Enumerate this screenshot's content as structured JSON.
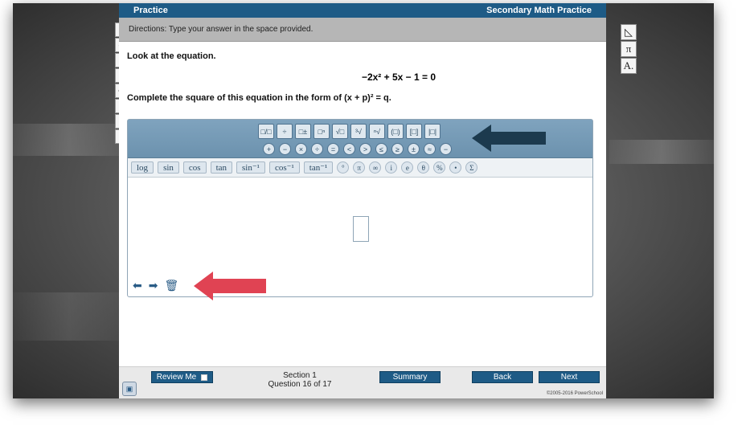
{
  "header": {
    "left_title": "Practice",
    "right_title": "Secondary Math Practice"
  },
  "directions": "Directions: Type your answer in the space provided.",
  "question": {
    "prompt": "Look at the equation.",
    "equation": "−2x² + 5x − 1 = 0",
    "instruction": "Complete the square of this equation in the form of (x + p)² = q."
  },
  "left_tools": [
    {
      "name": "pointer-icon",
      "glyph": "↖"
    },
    {
      "name": "protractor-icon",
      "glyph": "◠"
    },
    {
      "name": "highlighter-icon",
      "glyph": "✎"
    },
    {
      "name": "eraser-icon",
      "glyph": "▮"
    },
    {
      "name": "pencil-icon",
      "glyph": "✏"
    },
    {
      "name": "ruler-icon",
      "glyph": "═"
    },
    {
      "name": "eliminate-icon",
      "glyph": "✕"
    },
    {
      "name": "scratchwork-icon",
      "glyph": "∿"
    }
  ],
  "right_tools": [
    {
      "name": "triangle-icon",
      "glyph": "◺"
    },
    {
      "name": "pi-icon",
      "glyph": "π"
    },
    {
      "name": "notepad-icon",
      "glyph": "A."
    }
  ],
  "editor": {
    "templates": [
      "□/□",
      "÷",
      "□±",
      "□ⁿ",
      "√□",
      "³√",
      "ⁿ√",
      "(□)",
      "[□]",
      "|□|"
    ],
    "operators": [
      "+",
      "−",
      "×",
      "÷",
      "=",
      "<",
      ">",
      "≤",
      "≥",
      "±",
      "≈",
      "−"
    ],
    "functions": [
      "log",
      "sin",
      "cos",
      "tan",
      "sin⁻¹",
      "cos⁻¹",
      "tan⁻¹"
    ],
    "symbols": [
      "°",
      "π",
      "∞",
      "i",
      "e",
      "θ",
      "%",
      "•",
      "Σ"
    ]
  },
  "bottom": {
    "review_label": "Review Me",
    "section_line1": "Section 1",
    "section_line2": "Question 16 of 17",
    "summary_label": "Summary",
    "back_label": "Back",
    "next_label": "Next",
    "copyright": "©2005-2016 PowerSchool"
  },
  "colors": {
    "brand": "#1e5b86",
    "toolbar": "#7fa3be",
    "red_arrow": "#e04353",
    "dark_arrow": "#1c3a4e"
  }
}
